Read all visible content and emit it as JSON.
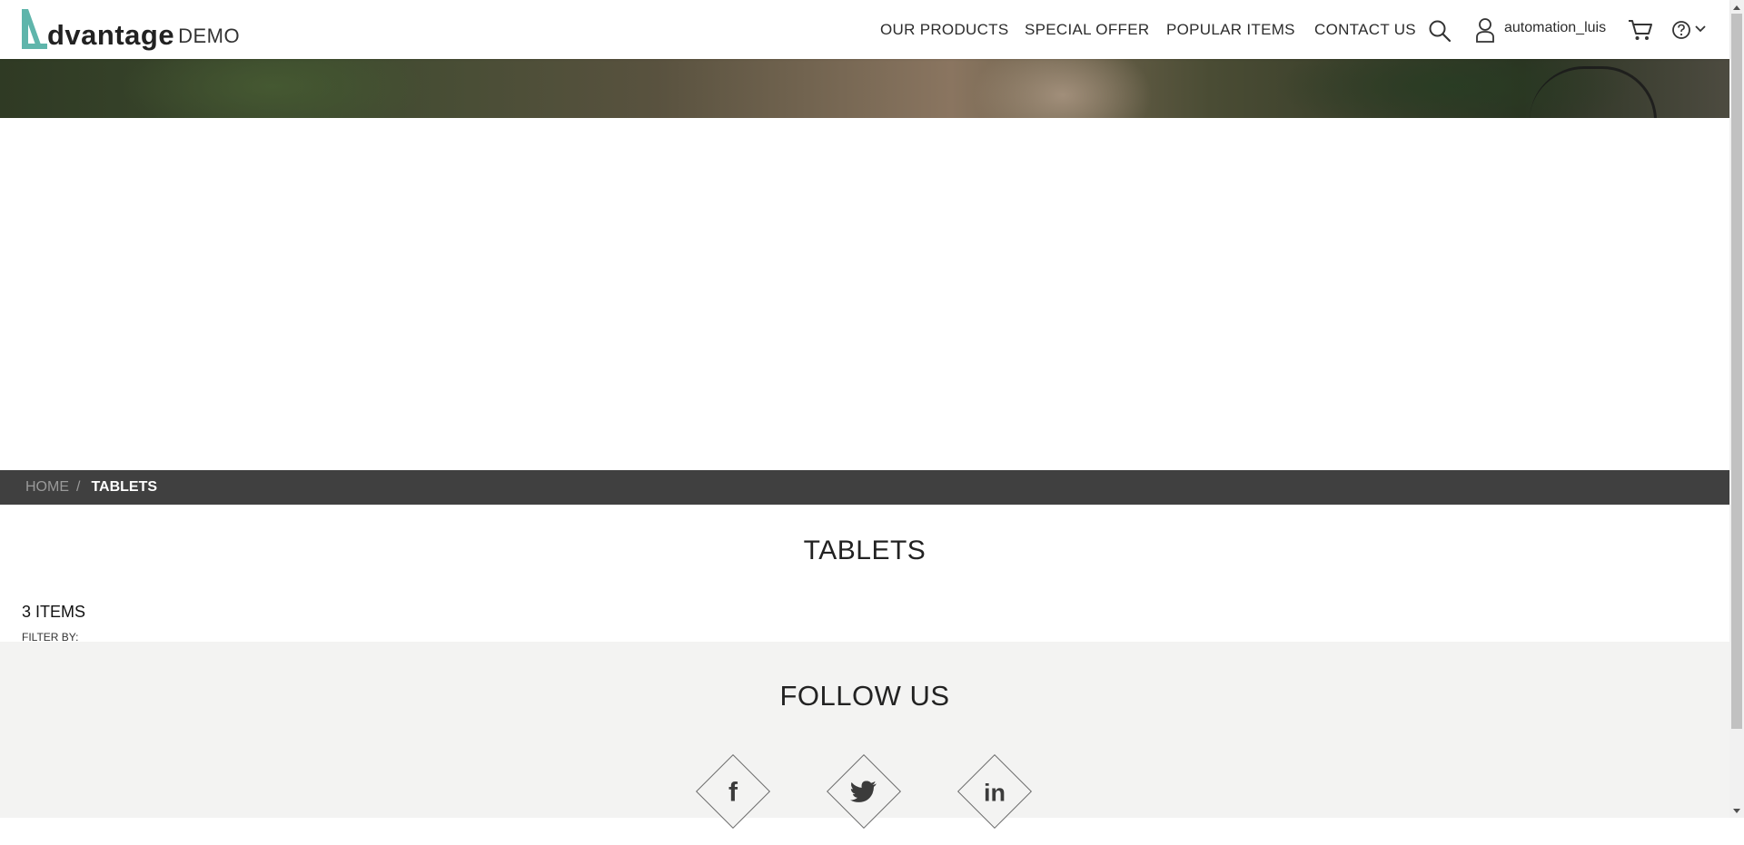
{
  "header": {
    "logo_word": "dvantage",
    "logo_demo": "DEMO",
    "nav": [
      {
        "label": "OUR PRODUCTS"
      },
      {
        "label": "SPECIAL OFFER"
      },
      {
        "label": "POPULAR ITEMS"
      },
      {
        "label": "CONTACT US"
      }
    ],
    "username": "automation_luis",
    "icons": [
      "search-icon",
      "user-icon",
      "cart-icon",
      "help-icon",
      "chevron-down-icon"
    ]
  },
  "breadcrumb": {
    "home": "HOME",
    "separator": "/",
    "current": "TABLETS"
  },
  "main": {
    "title": "TABLETS",
    "items_count": "3 ITEMS",
    "filter_label": "FILTER BY:"
  },
  "footer": {
    "follow_title": "FOLLOW US",
    "social": [
      {
        "icon": "facebook-icon",
        "glyph": "f"
      },
      {
        "icon": "twitter-icon",
        "glyph": ""
      },
      {
        "icon": "linkedin-icon",
        "glyph": "in"
      }
    ]
  },
  "colors": {
    "accent": "#5fb5ab",
    "breadcrumb_bg": "#404040",
    "footer_bg": "#f3f3f2"
  }
}
